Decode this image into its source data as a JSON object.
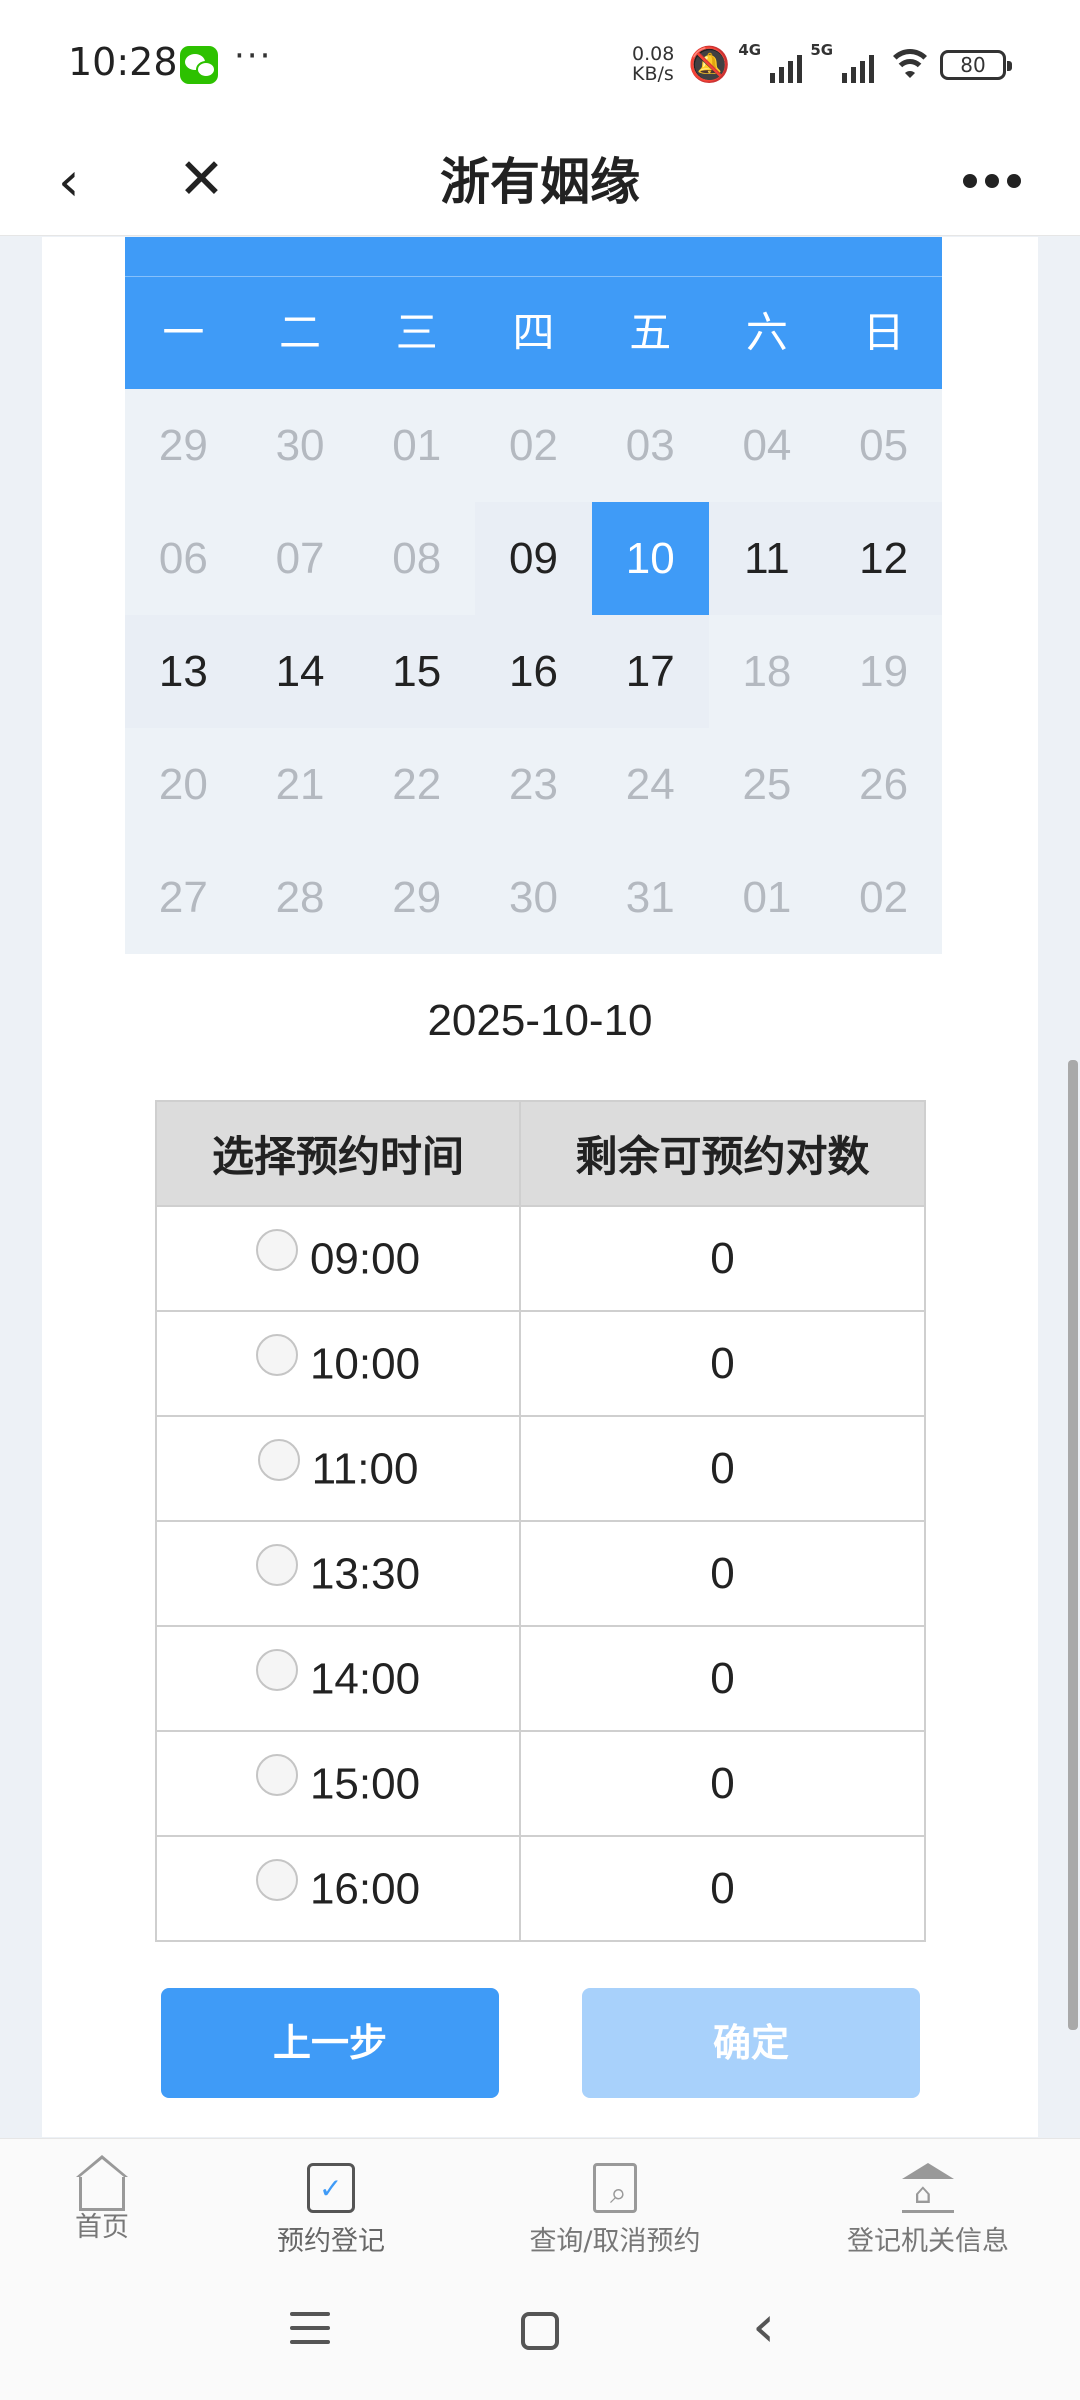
{
  "status_bar": {
    "time": "10:28",
    "net_speed_value": "0.08",
    "net_speed_unit": "KB/s",
    "sig1_label": "4G",
    "sig2_label": "5G",
    "battery": "80"
  },
  "title_bar": {
    "title": "浙有姻缘"
  },
  "calendar": {
    "weekdays": [
      "一",
      "二",
      "三",
      "四",
      "五",
      "六",
      "日"
    ],
    "days": [
      {
        "d": "29",
        "state": "other"
      },
      {
        "d": "30",
        "state": "other"
      },
      {
        "d": "01",
        "state": "disabled"
      },
      {
        "d": "02",
        "state": "disabled"
      },
      {
        "d": "03",
        "state": "disabled"
      },
      {
        "d": "04",
        "state": "disabled"
      },
      {
        "d": "05",
        "state": "disabled"
      },
      {
        "d": "06",
        "state": "disabled"
      },
      {
        "d": "07",
        "state": "disabled"
      },
      {
        "d": "08",
        "state": "disabled"
      },
      {
        "d": "09",
        "state": "active"
      },
      {
        "d": "10",
        "state": "selected"
      },
      {
        "d": "11",
        "state": "active"
      },
      {
        "d": "12",
        "state": "active"
      },
      {
        "d": "13",
        "state": "active"
      },
      {
        "d": "14",
        "state": "active"
      },
      {
        "d": "15",
        "state": "active"
      },
      {
        "d": "16",
        "state": "active"
      },
      {
        "d": "17",
        "state": "active"
      },
      {
        "d": "18",
        "state": "disabled"
      },
      {
        "d": "19",
        "state": "disabled"
      },
      {
        "d": "20",
        "state": "disabled"
      },
      {
        "d": "21",
        "state": "disabled"
      },
      {
        "d": "22",
        "state": "disabled"
      },
      {
        "d": "23",
        "state": "disabled"
      },
      {
        "d": "24",
        "state": "disabled"
      },
      {
        "d": "25",
        "state": "disabled"
      },
      {
        "d": "26",
        "state": "disabled"
      },
      {
        "d": "27",
        "state": "disabled"
      },
      {
        "d": "28",
        "state": "disabled"
      },
      {
        "d": "29",
        "state": "disabled"
      },
      {
        "d": "30",
        "state": "disabled"
      },
      {
        "d": "31",
        "state": "disabled"
      },
      {
        "d": "01",
        "state": "other"
      },
      {
        "d": "02",
        "state": "other"
      }
    ]
  },
  "selected_date": "2025-10-10",
  "time_table": {
    "col_time": "选择预约时间",
    "col_remaining": "剩余可预约对数",
    "rows": [
      {
        "time": "09:00",
        "remaining": "0"
      },
      {
        "time": "10:00",
        "remaining": "0"
      },
      {
        "time": "11:00",
        "remaining": "0"
      },
      {
        "time": "13:30",
        "remaining": "0"
      },
      {
        "time": "14:00",
        "remaining": "0"
      },
      {
        "time": "15:00",
        "remaining": "0"
      },
      {
        "time": "16:00",
        "remaining": "0"
      }
    ]
  },
  "buttons": {
    "prev": "上一步",
    "confirm": "确定"
  },
  "bottom_nav": {
    "items": [
      {
        "label": "首页",
        "icon": "home-icon"
      },
      {
        "label": "预约登记",
        "icon": "calendar-check-icon"
      },
      {
        "label": "查询/取消预约",
        "icon": "document-search-icon"
      },
      {
        "label": "登记机关信息",
        "icon": "institution-icon"
      }
    ]
  },
  "colors": {
    "accent": "#3f9bf7",
    "accent_disabled": "#a8d1fb",
    "calendar_bg": "#edf2f7"
  }
}
